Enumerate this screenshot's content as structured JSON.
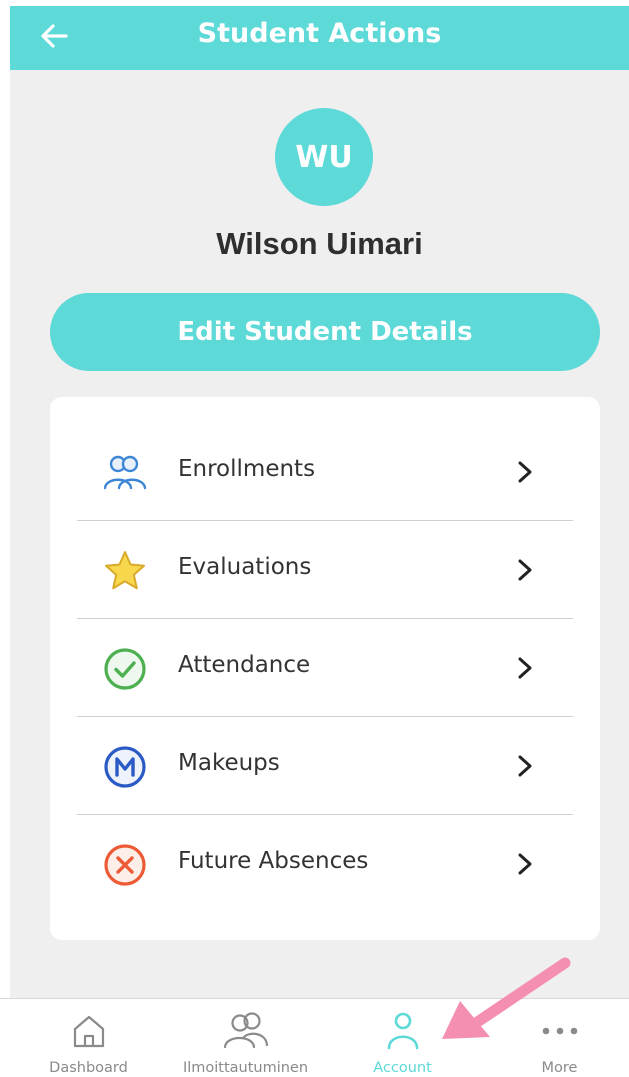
{
  "header": {
    "title": "Student Actions",
    "back_icon": "arrow-left-icon"
  },
  "student": {
    "initials": "WU",
    "name": "Wilson Uimari"
  },
  "edit_button": {
    "label": "Edit Student Details"
  },
  "actions": [
    {
      "label": "Enrollments",
      "icon": "people-icon",
      "color": "#3d86d6"
    },
    {
      "label": "Evaluations",
      "icon": "star-icon",
      "color": "#f2c234"
    },
    {
      "label": "Attendance",
      "icon": "check-circle-icon",
      "color": "#4caf50"
    },
    {
      "label": "Makeups",
      "icon": "m-circle-icon",
      "color": "#2a5bc4"
    },
    {
      "label": "Future Absences",
      "icon": "x-circle-icon",
      "color": "#ec5b36"
    }
  ],
  "tabs": [
    {
      "label": "Dashboard",
      "icon": "home-icon",
      "active": false
    },
    {
      "label": "Ilmoittautuminen",
      "icon": "people-icon",
      "active": false
    },
    {
      "label": "Account",
      "icon": "person-icon",
      "active": true
    },
    {
      "label": "More",
      "icon": "more-dots-icon",
      "active": false
    }
  ],
  "colors": {
    "accent": "#5dd9d7",
    "background": "#efefef",
    "pointer_arrow": "#f48fb1"
  }
}
